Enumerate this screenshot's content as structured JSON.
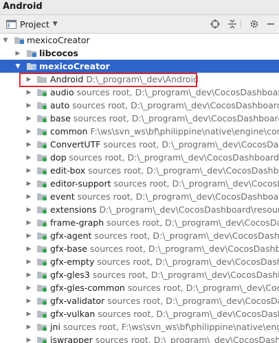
{
  "window": {
    "title": "Android"
  },
  "toolbar": {
    "view_label": "Project",
    "buttons": [
      {
        "name": "locate-target-icon",
        "glyph": "⊕"
      },
      {
        "name": "collapse-all-icon",
        "glyph": "⇕"
      },
      {
        "name": "settings-gear-icon",
        "glyph": "⚙"
      },
      {
        "name": "hide-panel-icon",
        "glyph": "—"
      }
    ]
  },
  "tree": {
    "root": {
      "label": "mexicoCreator"
    },
    "libcocos": {
      "label": "libcocos"
    },
    "module": {
      "label": "mexicoCreator"
    },
    "items": [
      {
        "name": "Android",
        "meta": "",
        "path": "D:\\_program\\_dev\\Android"
      },
      {
        "name": "audio",
        "meta": "sources root,",
        "path": "D:\\_program\\_dev\\CocosDashboard\\re"
      },
      {
        "name": "auto",
        "meta": "sources root,",
        "path": "D:\\_program\\_dev\\CocosDashboard\\res"
      },
      {
        "name": "base",
        "meta": "sources root,",
        "path": "D:\\_program\\_dev\\CocosDashboard\\res"
      },
      {
        "name": "common",
        "meta": "",
        "path": "F:\\ws\\svn_ws\\bf\\philippine\\native\\engine\\commo"
      },
      {
        "name": "ConvertUTF",
        "meta": "sources root,",
        "path": "D:\\_program\\_dev\\CocosDashbo"
      },
      {
        "name": "dop",
        "meta": "sources root,",
        "path": "D:\\_program\\_dev\\CocosDashboard\\res"
      },
      {
        "name": "edit-box",
        "meta": "sources root,",
        "path": "D:\\_program\\_dev\\CocosDashbo"
      },
      {
        "name": "editor-support",
        "meta": "sources root,",
        "path": "D:\\_program\\_dev\\CocosD"
      },
      {
        "name": "event",
        "meta": "sources root,",
        "path": "D:\\_program\\_dev\\CocosDashboard\\re"
      },
      {
        "name": "extensions",
        "meta": "",
        "path": "D:\\_program\\_dev\\CocosDashboard\\resources\\"
      },
      {
        "name": "frame-graph",
        "meta": "sources root,",
        "path": "D:\\_program\\_dev\\CocosDash"
      },
      {
        "name": "gfx-agent",
        "meta": "sources root,",
        "path": "D:\\_program\\_dev\\CocosDashbo"
      },
      {
        "name": "gfx-base",
        "meta": "sources root,",
        "path": "D:\\_program\\_dev\\CocosDashboa"
      },
      {
        "name": "gfx-empty",
        "meta": "sources root,",
        "path": "D:\\_program\\_dev\\CocosDashbo"
      },
      {
        "name": "gfx-gles3",
        "meta": "sources root,",
        "path": "D:\\_program\\_dev\\CocosDashbo"
      },
      {
        "name": "gfx-gles-common",
        "meta": "sources root,",
        "path": "D:\\_program\\_dev\\CocosD"
      },
      {
        "name": "gfx-validator",
        "meta": "sources root,",
        "path": "D:\\_program\\_dev\\CocosDash"
      },
      {
        "name": "gfx-vulkan",
        "meta": "sources root,",
        "path": "D:\\_program\\_dev\\CocosDashbo"
      },
      {
        "name": "jni",
        "meta": "sources root,",
        "path": "F:\\ws\\svn_ws\\bf\\philippine\\native\\engine\\"
      },
      {
        "name": "jswrapper",
        "meta": "sources root,",
        "path": "D:\\_program\\_dev\\CocosDashbo"
      }
    ]
  },
  "colors": {
    "selection": "#2f65ca",
    "highlight_border": "#e0242b",
    "folder": "#b7bdc4",
    "source_dot": "#28a745"
  }
}
